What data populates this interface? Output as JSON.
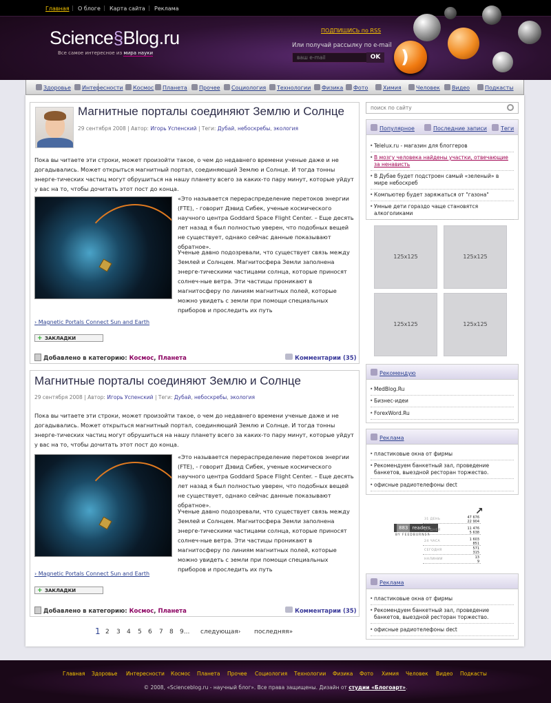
{
  "topnav": [
    "Главная",
    "О блоге",
    "Карта сайта",
    "Реклама"
  ],
  "logo": {
    "part1": "Science",
    "part2": "Blog.ru",
    "tagline_pre": "Все самое интересное из",
    "tagline_bold": "мира науки"
  },
  "subscribe": {
    "rss_link": "ПОДПИШИСЬ по RSS",
    "text": "Или получай рассылку по e-mail",
    "placeholder": "ваш e-mail",
    "button": "OK"
  },
  "nav": [
    "Здоровье",
    "Интересности",
    "Космос",
    "Планета",
    "Прочее",
    "Социология",
    "Технологии",
    "Физика",
    "Фото",
    "Химия",
    "Человек",
    "Видео",
    "Подкасты"
  ],
  "posts": [
    {
      "title": "Магнитные порталы соединяют Землю и Солнце",
      "date": "29 сентября 2008",
      "author_label": "| Автор:",
      "author": "Игорь Успенский",
      "tags_label": "| Теги:",
      "tags": [
        "Дубай",
        "небоскребы",
        "экология"
      ],
      "intro": "Пока вы читаете эти строки, может произойти такое, о чем до недавнего времени ученые даже и не догадывались. Может открыться магнитный портал, соединяющий Землю и Солнце. И тогда тонны энерге-тических частиц могут обрушиться на нашу планету всего за каких-то пару минут, которые уйдут у вас на то, чтобы дочитать этот пост до конца.",
      "quote": "«Это называется перераспределение перетоков энергии (FTE), - говорит Дэвид Сибек, ученые космического научного центра Goddard Space Flight Center. – Еще десять лет назад я был полностью уверен, что подобных вещей не существует, однако сейчас данные показывают обратное».",
      "body": "Ученые давно подозревали, что существует связь между Землей и Солнцем. Магнитосфера Земли заполнена энерге-тическими частицами солнца, которые приносят солнеч-ные ветра. Эти частицы проникают в магнитосферу по линиям магнитных полей, которые можно увидеть с земли при помощи специальных приборов и проследить их путь",
      "source": "Magnetic Portals Connect Sun and Earth",
      "bookmark": "ЗАКЛАДКИ",
      "category_label": "Добавлено в категорию:",
      "categories": [
        "Космос",
        "Планета"
      ],
      "comments": "Комментарии (35)"
    },
    {
      "title": "Магнитные порталы соединяют Землю и Солнце",
      "date": "29 сентября 2008",
      "author_label": "| Автор:",
      "author": "Игорь Успенский",
      "tags_label": "| Теги:",
      "tags": [
        "Дубай",
        "небоскребы",
        "экология"
      ],
      "intro": "Пока вы читаете эти строки, может произойти такое, о чем до недавнего времени ученые даже и не догадывались. Может открыться магнитный портал, соединяющий Землю и Солнце. И тогда тонны энерге-тических частиц могут обрушиться на нашу планету всего за каких-то пару минут, которые уйдут у вас на то, чтобы дочитать этот пост до конца.",
      "quote": "«Это называется перераспределение перетоков энергии (FTE), - говорит Дэвид Сибек, ученые космического научного центра Goddard Space Flight Center. – Еще десять лет назад я был полностью уверен, что подобных вещей не существует, однако сейчас данные показывают обратное».",
      "body": "Ученые давно подозревали, что существует связь между Землей и Солнцем. Магнитосфера Земли заполнена энерге-тическими частицами солнца, которые приносят солнеч-ные ветра. Эти частицы проникают в магнитосферу по линиям магнитных полей, которые можно увидеть с земли при помощи специальных приборов и проследить их путь",
      "source": "Magnetic Portals Connect Sun and Earth",
      "bookmark": "ЗАКЛАДКИ",
      "category_label": "Добавлено в категорию:",
      "categories": [
        "Космос",
        "Планета"
      ],
      "comments": "Комментарии (35)"
    }
  ],
  "pager": {
    "pages": [
      "1",
      "2",
      "3",
      "4",
      "5",
      "6",
      "7",
      "8",
      "9..."
    ],
    "next": "следующая›",
    "last": "последняя»"
  },
  "search": {
    "placeholder": "поиск по сайту"
  },
  "tabs": {
    "popular": "Популярное",
    "recent": "Последние записи",
    "tags": "Теги"
  },
  "popular": [
    "Telelux.ru - магазин для блоггеров",
    "В мозгу человека найдены участки, отвечающие за ненависть",
    "В Дубае будет подстроен самый «зеленый» в мире небоскреб",
    "Компьютер будет заряжаться от \"газона\"",
    "Умные дети гораздо чаще становятся алкоголиками"
  ],
  "ads": [
    "125x125",
    "125x125",
    "125x125",
    "125x125"
  ],
  "recommend": {
    "title": "Рекомендую",
    "items": [
      "MedBlog.Ru",
      "Бизнес-идеи",
      "ForexWord.Ru"
    ]
  },
  "reklama1": {
    "title": "Реклама",
    "items": [
      "пластиковые окна от фирмы",
      "Рекомендуем банкетный зал, проведение банкетов, выездной ресторан торжество.",
      "офисные радиотелефоны dect"
    ]
  },
  "reklama2": {
    "title": "Реклама",
    "items": [
      "пластиковые окна от фирмы",
      "Рекомендуем банкетный зал, проведение банкетов, выездной ресторан торжество.",
      "офисные радиотелефоны dect"
    ]
  },
  "feedburner": {
    "count": "883",
    "readers": "readers",
    "by": "BY FEEDBURNER",
    "rows": [
      {
        "label": "31 ДЕНЬ",
        "v1": "47 676",
        "v2": "22 904"
      },
      {
        "label": "07 ДНЕЙ",
        "v1": "11 476",
        "v2": "5 638"
      },
      {
        "label": "24 ЧАСА",
        "v1": "1 603",
        "v2": "851"
      },
      {
        "label": "СЕГОДНЯ",
        "v1": "571",
        "v2": "315"
      },
      {
        "label": "НАЛИНИИ",
        "v1": "13",
        "v2": "9"
      }
    ]
  },
  "footer": {
    "links": [
      "Главная",
      "Здоровье",
      "Интересности",
      "Космос",
      "Планета",
      "Прочее",
      "Социология",
      "Технологии",
      "Физика",
      "Фото",
      "Химия",
      "Человек",
      "Видео",
      "Подкасты"
    ],
    "copyright_pre": "© 2008, «Scienceblog.ru - научный блог». Все права защищены. Дизайн от",
    "copyright_link": "студии «Блогоарт»",
    "copyright_post": "."
  }
}
